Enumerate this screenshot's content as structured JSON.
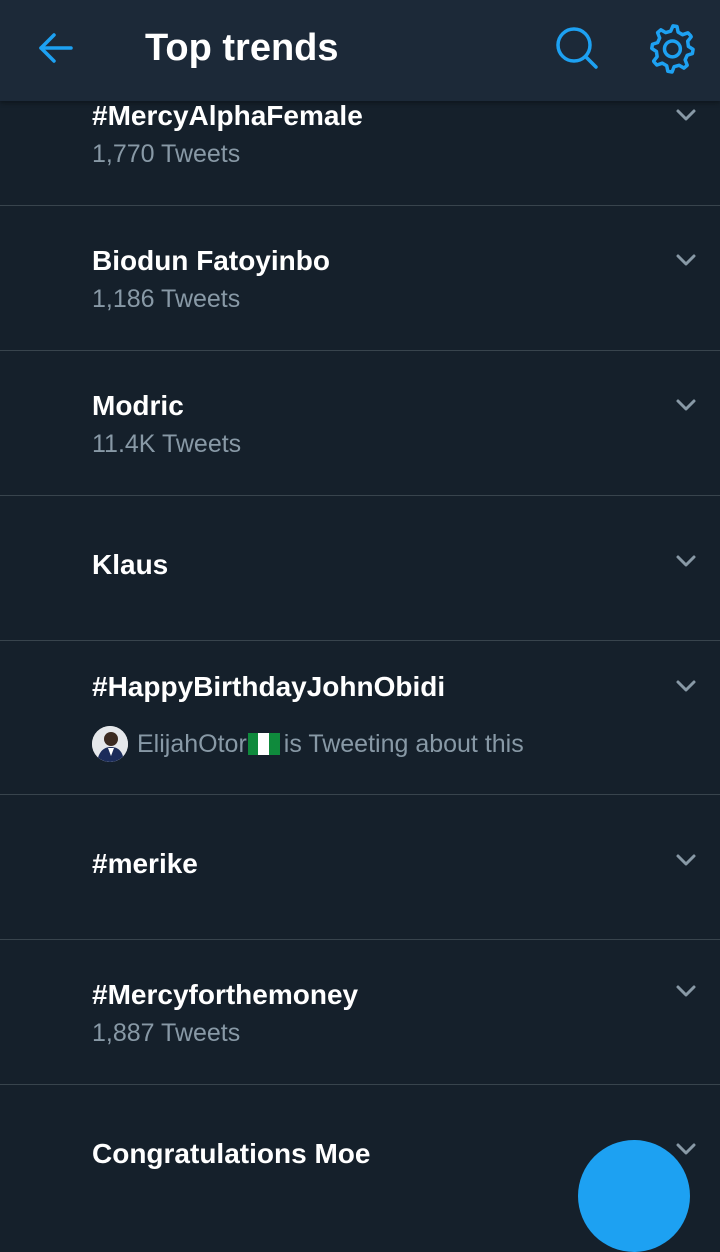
{
  "header": {
    "title": "Top trends",
    "back_icon": "arrow-left-icon",
    "search_icon": "search-icon",
    "settings_icon": "gear-icon"
  },
  "colors": {
    "accent": "#1da1f2",
    "background": "#15202b",
    "header_background": "#1c2938",
    "secondary_text": "#8899a6",
    "divider": "#38444d"
  },
  "trends": [
    {
      "name": "#MercyAlphaFemale",
      "count": "1,770 Tweets"
    },
    {
      "name": "Biodun Fatoyinbo",
      "count": "1,186 Tweets"
    },
    {
      "name": "Modric",
      "count": "11.4K Tweets"
    },
    {
      "name": "Klaus",
      "count": ""
    },
    {
      "name": "#HappyBirthdayJohnObidi",
      "tweeting_user": "ElijahOtor",
      "tweeting_suffix": "is Tweeting about this",
      "flag": "nigeria-flag"
    },
    {
      "name": "#merike",
      "count": ""
    },
    {
      "name": "#Mercyforthemoney",
      "count": "1,887 Tweets"
    },
    {
      "name": "Congratulations Moe",
      "count": ""
    }
  ]
}
